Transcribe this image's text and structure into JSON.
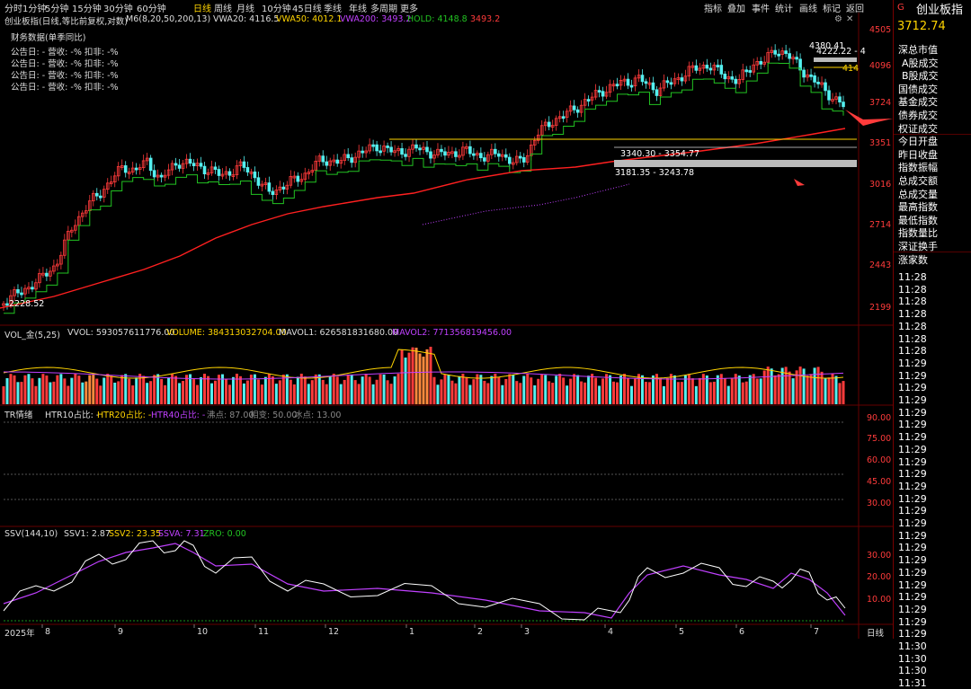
{
  "toolbar": {
    "periods": [
      "分时",
      "1分钟",
      "5分钟",
      "15分钟",
      "30分钟",
      "60分钟",
      "日线",
      "周线",
      "月线",
      "10分钟",
      "45日线",
      "季线",
      "年线",
      "多周期",
      "更多"
    ],
    "active_period": "日线",
    "right_items": [
      "指标",
      "叠加",
      "事件",
      "统计",
      "画线",
      "标记",
      "返回"
    ],
    "window_icons": [
      "gear-icon",
      "close-icon"
    ]
  },
  "main_legend": {
    "title": "创业板指(日线,等比前复权,对数)",
    "ma_label": "M6(8,20,50,200,13)",
    "vwa20": "VWA20: 4116.5",
    "vwa50": "VWA50: 4012.1",
    "vwa200": "VWA200: 3493.2",
    "hold": "HOLD: 4148.8",
    "last": "3493.2"
  },
  "finance": {
    "title": "财务数据(单季同比)",
    "rows": [
      "公告日: -   营收: -%   扣非: -%",
      "公告日: -   营收: -%   扣非: -%",
      "公告日: -   营收: -%   扣非: -%",
      "公告日: -   营收: -%   扣非: -%"
    ]
  },
  "annotations": {
    "high": "4380.41",
    "low": "2228.52",
    "range_high": "4222.22 - 4",
    "range_mid": "3340.30 - 3354.77",
    "range_low": "3181.35 - 3243.78",
    "side_value": "414"
  },
  "price_axis": [
    "4505",
    "4096",
    "3724",
    "3351",
    "3016",
    "2714",
    "2443",
    "2199"
  ],
  "vol_legend": {
    "title": "VOL_金(5,25)",
    "vvol": "VVOL: 593057611776.00",
    "volume": "VOLUME: 384313032704.00",
    "mavol1": "MAVOL1: 626581831680.00",
    "mavol2": "MAVOL2: 771356819456.00"
  },
  "tr_legend": {
    "title": "TR情绪",
    "h10": "HTR10占比: -",
    "h20": "HTR20占比: -",
    "h40": "HTR40占比: -",
    "boil": "沸点: 87.00",
    "change": "相变: 50.00",
    "freeze": "冰点: 13.00"
  },
  "tr_axis": [
    "90.00",
    "75.00",
    "60.00",
    "45.00",
    "30.00"
  ],
  "ssv_legend": {
    "title": "SSV(144,10)",
    "ssv1": "SSV1: 2.87",
    "ssv2": "SSV2: 23.35",
    "ssva": "SSVA: 7.31",
    "zro": "ZRO: 0.00"
  },
  "ssv_axis": [
    "30.00",
    "20.00",
    "10.00"
  ],
  "x_axis": {
    "year": "2025年",
    "months": [
      "8",
      "9",
      "10",
      "11",
      "12",
      "1",
      "2",
      "3",
      "4",
      "5",
      "6",
      "7"
    ],
    "period": "日线"
  },
  "sidebar": {
    "marker": "G",
    "title": "创业板指",
    "price": "3712.74",
    "items": [
      "深总市值",
      "A股成交",
      "B股成交",
      "国债成交",
      "基金成交",
      "债券成交",
      "权证成交",
      "今日开盘",
      "昨日收盘",
      "指数振幅",
      "总成交额",
      "总成交量",
      "最高指数",
      "最低指数",
      "指数量比",
      "深证换手",
      "涨家数"
    ],
    "times": [
      "11:28",
      "11:28",
      "11:28",
      "11:28",
      "11:28",
      "11:28",
      "11:28",
      "11:29",
      "11:29",
      "11:29",
      "11:29",
      "11:29",
      "11:29",
      "11:29",
      "11:29",
      "11:29",
      "11:29",
      "11:29",
      "11:29",
      "11:29",
      "11:29",
      "11:29",
      "11:29",
      "11:29",
      "11:29",
      "11:29",
      "11:29",
      "11:29",
      "11:29",
      "11:29",
      "11:30",
      "11:30",
      "11:30",
      "11:31"
    ]
  },
  "colors": {
    "up": "#ff3b3b",
    "down": "#54f0f0",
    "ma_green": "#22c322",
    "ma_red": "#ff2020",
    "ma_purple": "#c040ff",
    "yellow": "#ffd400"
  }
}
